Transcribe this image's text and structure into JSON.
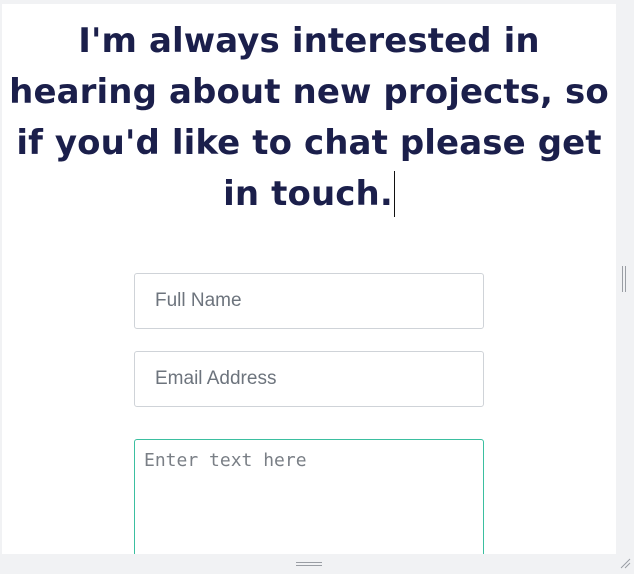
{
  "contact": {
    "heading": "I'm always interested in hearing about new projects, so if you'd like to chat please get in touch.",
    "name_placeholder": "Full Name",
    "email_placeholder": "Email Address",
    "message_placeholder": "Enter text here"
  },
  "colors": {
    "heading_text": "#1b1f4b",
    "focused_border": "#3bbfa0",
    "field_border": "#cfd3d8",
    "page_background": "#f1f2f4"
  },
  "icons": {
    "vertical_resize": "vertical-resize-handle-icon",
    "horizontal_resize": "horizontal-resize-handle-icon",
    "corner_resize": "resize-grip-icon"
  }
}
